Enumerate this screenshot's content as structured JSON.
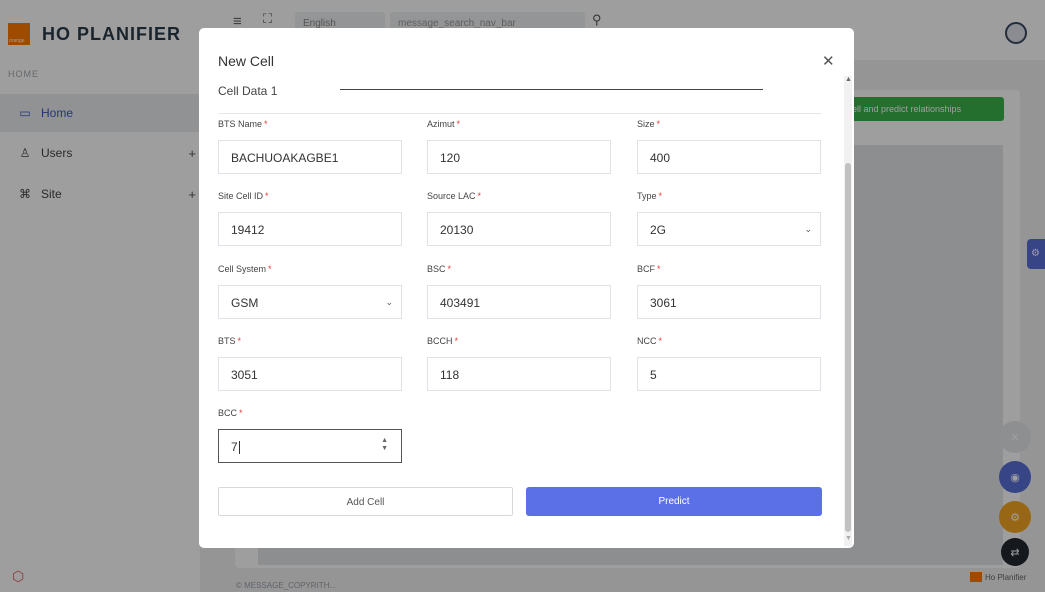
{
  "app": {
    "brand": "HO PLANIFIER",
    "logo_text": "orange",
    "section_label": "HOME"
  },
  "sidebar": {
    "items": [
      {
        "label": "Home",
        "icon": "monitor-icon"
      },
      {
        "label": "Users",
        "icon": "user-icon",
        "expandable": "+"
      },
      {
        "label": "Site",
        "icon": "command-icon",
        "expandable": "+"
      }
    ]
  },
  "topbar": {
    "language": "English",
    "search_placeholder": "message_search_nav_bar"
  },
  "background": {
    "action_button": "ell and predict relationships",
    "footer": "© MESSAGE_COPYRITH...",
    "footer_brand": "Ho Planifier"
  },
  "modal": {
    "title": "New Cell",
    "section_title": "Cell Data 1",
    "required_mark": "*",
    "fields": {
      "bts_name": {
        "label": "BTS Name",
        "value": "BACHUOAKAGBE1"
      },
      "azimut": {
        "label": "Azimut",
        "value": "120"
      },
      "size": {
        "label": "Size",
        "value": "400"
      },
      "site_cell_id": {
        "label": "Site Cell ID",
        "value": "19412"
      },
      "source_lac": {
        "label": "Source LAC",
        "value": "20130"
      },
      "type": {
        "label": "Type",
        "value": "2G"
      },
      "cell_system": {
        "label": "Cell System",
        "value": "GSM"
      },
      "bsc": {
        "label": "BSC",
        "value": "403491"
      },
      "bcf": {
        "label": "BCF",
        "value": "3061"
      },
      "bts": {
        "label": "BTS",
        "value": "3051"
      },
      "bcch": {
        "label": "BCCH",
        "value": "118"
      },
      "ncc": {
        "label": "NCC",
        "value": "5"
      },
      "bcc": {
        "label": "BCC",
        "value": "7"
      }
    },
    "buttons": {
      "add": "Add Cell",
      "predict": "Predict"
    }
  },
  "colors": {
    "accent": "#5b6fe6",
    "required": "#e53935",
    "green_action": "#3cb44b",
    "brand_orange": "#ff7900"
  }
}
